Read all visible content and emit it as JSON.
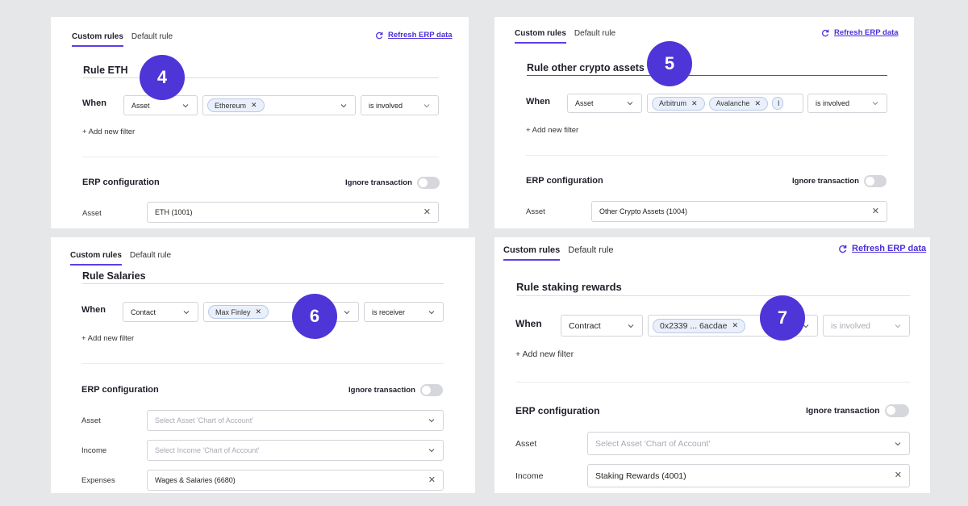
{
  "shared": {
    "custom_rules": "Custom rules",
    "default_rule": "Default rule",
    "refresh": "Refresh ERP data",
    "when": "When",
    "add_filter": "+ Add new filter",
    "erp_config": "ERP configuration",
    "ignore_transaction": "Ignore transaction",
    "asset_label": "Asset",
    "income_label": "Income",
    "expenses_label": "Expenses"
  },
  "panel4": {
    "badge": "4",
    "rule_title": "Rule ETH",
    "filter_type": "Asset",
    "chips": [
      "Ethereum"
    ],
    "condition": "is involved",
    "asset_value": "ETH (1001)"
  },
  "panel5": {
    "badge": "5",
    "rule_title": "Rule other crypto assets",
    "filter_type": "Asset",
    "chips": [
      "Arbitrum",
      "Avalanche"
    ],
    "chip_cut": "I",
    "condition": "is involved",
    "asset_value": "Other Crypto Assets (1004)"
  },
  "panel6": {
    "badge": "6",
    "rule_title": "Rule Salaries",
    "filter_type": "Contact",
    "chips": [
      "Max Finley"
    ],
    "condition": "is receiver",
    "asset_placeholder": "Select Asset 'Chart of Account'",
    "income_placeholder": "Select Income 'Chart of Account'",
    "expenses_value": "Wages & Salaries (6680)"
  },
  "panel7": {
    "badge": "7",
    "rule_title": "Rule staking rewards",
    "filter_type": "Contract",
    "chips": [
      "0x2339 ... 6acdae"
    ],
    "condition": "is involved",
    "asset_placeholder": "Select Asset 'Chart of Account'",
    "income_value": "Staking Rewards (4001)"
  },
  "colors": {
    "accent": "#4d35d8",
    "link": "#4a2fd8",
    "chip_bg": "#eaf0fb",
    "background": "#e6e7e9"
  },
  "icons": {
    "refresh": "refresh-icon",
    "chevron": "chevron-down-icon",
    "clear": "close-icon"
  }
}
